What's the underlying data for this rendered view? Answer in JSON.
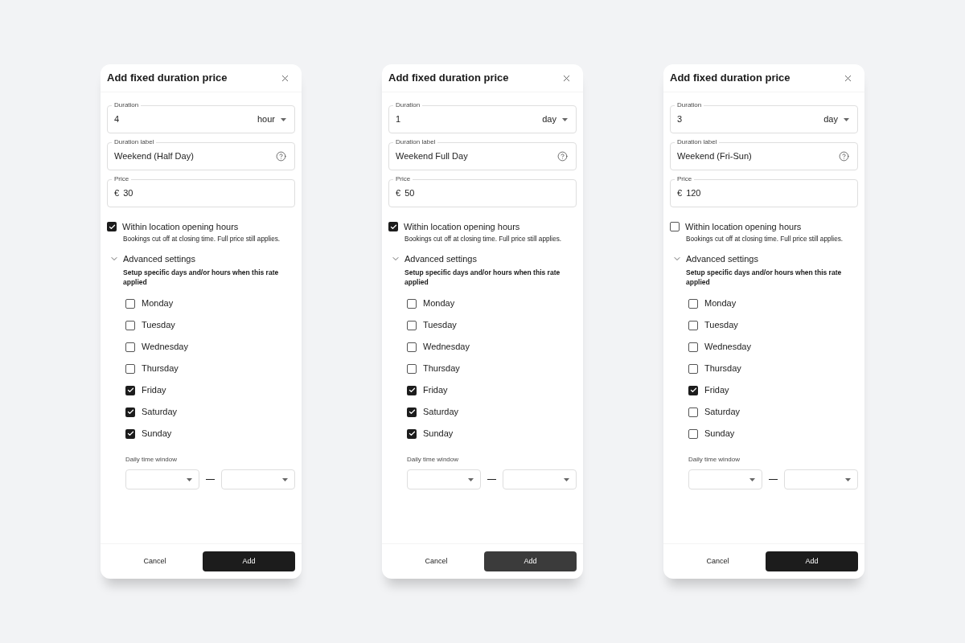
{
  "dialogs": [
    {
      "title": "Add fixed duration price",
      "duration": {
        "label": "Duration",
        "value": "4",
        "unit": "hour"
      },
      "duration_label": {
        "label": "Duration label",
        "value": "Weekend (Half Day)"
      },
      "price": {
        "label": "Price",
        "currency": "€",
        "value": "30"
      },
      "opening_hours": {
        "label": "Within location opening hours",
        "checked": true,
        "hint": "Bookings cut off at closing time. Full price still applies."
      },
      "advanced": {
        "label": "Advanced settings",
        "expanded": true,
        "description": "Setup specific days and/or hours when this rate applied",
        "days": [
          {
            "label": "Monday",
            "checked": false
          },
          {
            "label": "Tuesday",
            "checked": false
          },
          {
            "label": "Wednesday",
            "checked": false
          },
          {
            "label": "Thursday",
            "checked": false
          },
          {
            "label": "Friday",
            "checked": true
          },
          {
            "label": "Saturday",
            "checked": true
          },
          {
            "label": "Sunday",
            "checked": true
          }
        ],
        "time_window": {
          "label": "Daily time window"
        }
      },
      "buttons": {
        "cancel": "Cancel",
        "add": {
          "label": "Add",
          "hovered": false
        }
      }
    },
    {
      "title": "Add fixed duration price",
      "duration": {
        "label": "Duration",
        "value": "1",
        "unit": "day"
      },
      "duration_label": {
        "label": "Duration label",
        "value": "Weekend Full Day"
      },
      "price": {
        "label": "Price",
        "currency": "€",
        "value": "50"
      },
      "opening_hours": {
        "label": "Within location opening hours",
        "checked": true,
        "hint": "Bookings cut off at closing time. Full price still applies."
      },
      "advanced": {
        "label": "Advanced settings",
        "expanded": true,
        "description": "Setup specific days and/or hours when this rate applied",
        "days": [
          {
            "label": "Monday",
            "checked": false
          },
          {
            "label": "Tuesday",
            "checked": false
          },
          {
            "label": "Wednesday",
            "checked": false
          },
          {
            "label": "Thursday",
            "checked": false
          },
          {
            "label": "Friday",
            "checked": true
          },
          {
            "label": "Saturday",
            "checked": true
          },
          {
            "label": "Sunday",
            "checked": true
          }
        ],
        "time_window": {
          "label": "Daily time window"
        }
      },
      "buttons": {
        "cancel": "Cancel",
        "add": {
          "label": "Add",
          "hovered": true
        }
      }
    },
    {
      "title": "Add fixed duration price",
      "duration": {
        "label": "Duration",
        "value": "3",
        "unit": "day"
      },
      "duration_label": {
        "label": "Duration label",
        "value": "Weekend (Fri-Sun)"
      },
      "price": {
        "label": "Price",
        "currency": "€",
        "value": "120"
      },
      "opening_hours": {
        "label": "Within location opening hours",
        "checked": false,
        "hint": "Bookings cut off at closing time. Full price still applies."
      },
      "advanced": {
        "label": "Advanced settings",
        "expanded": true,
        "description": "Setup specific days and/or hours when this rate applied",
        "days": [
          {
            "label": "Monday",
            "checked": false
          },
          {
            "label": "Tuesday",
            "checked": false
          },
          {
            "label": "Wednesday",
            "checked": false
          },
          {
            "label": "Thursday",
            "checked": false
          },
          {
            "label": "Friday",
            "checked": true
          },
          {
            "label": "Saturday",
            "checked": false
          },
          {
            "label": "Sunday",
            "checked": false
          }
        ],
        "time_window": {
          "label": "Daily time window"
        }
      },
      "buttons": {
        "cancel": "Cancel",
        "add": {
          "label": "Add",
          "hovered": false
        }
      }
    }
  ]
}
